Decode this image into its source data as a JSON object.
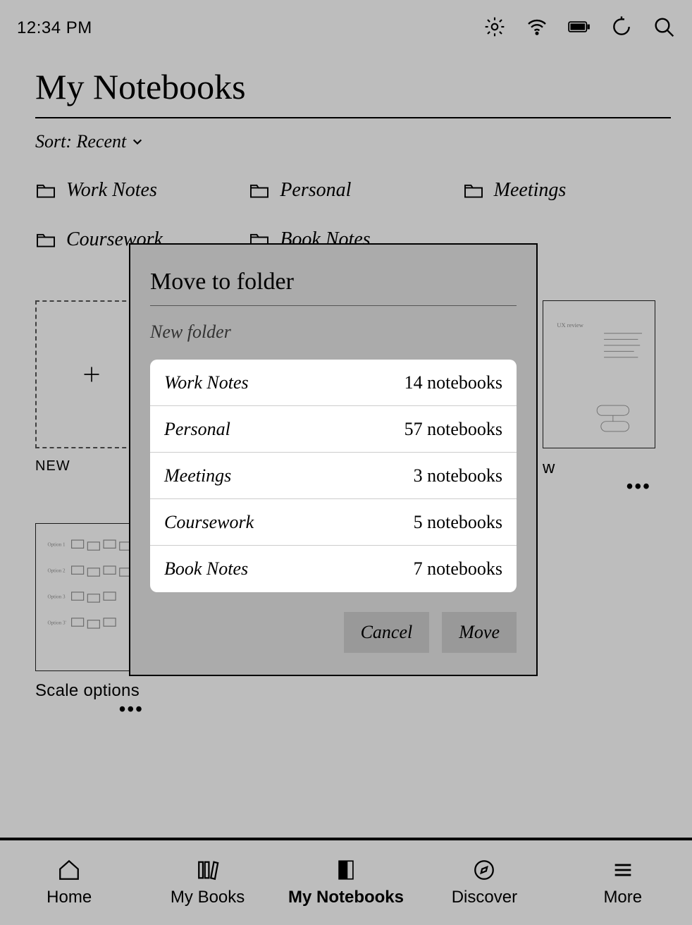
{
  "statusbar": {
    "time": "12:34 PM"
  },
  "page_title": "My Notebooks",
  "sort": {
    "label": "Sort: Recent"
  },
  "folders": [
    {
      "name": "Work Notes"
    },
    {
      "name": "Personal"
    },
    {
      "name": "Meetings"
    },
    {
      "name": "Coursework"
    },
    {
      "name": "Book Notes"
    }
  ],
  "notebooks": {
    "new_label": "NEW",
    "items": [
      {
        "title": "…",
        "visible_title": "w"
      },
      {
        "title": "Scale options"
      }
    ]
  },
  "dialog": {
    "title": "Move to folder",
    "new_folder_label": "New folder",
    "folders": [
      {
        "name": "Work Notes",
        "count_label": "14 notebooks"
      },
      {
        "name": "Personal",
        "count_label": "57 notebooks"
      },
      {
        "name": "Meetings",
        "count_label": "3 notebooks"
      },
      {
        "name": "Coursework",
        "count_label": "5 notebooks"
      },
      {
        "name": "Book Notes",
        "count_label": "7 notebooks"
      }
    ],
    "cancel_label": "Cancel",
    "move_label": "Move"
  },
  "bottomnav": {
    "items": [
      {
        "label": "Home"
      },
      {
        "label": "My Books"
      },
      {
        "label": "My Notebooks"
      },
      {
        "label": "Discover"
      },
      {
        "label": "More"
      }
    ],
    "active_index": 2
  }
}
